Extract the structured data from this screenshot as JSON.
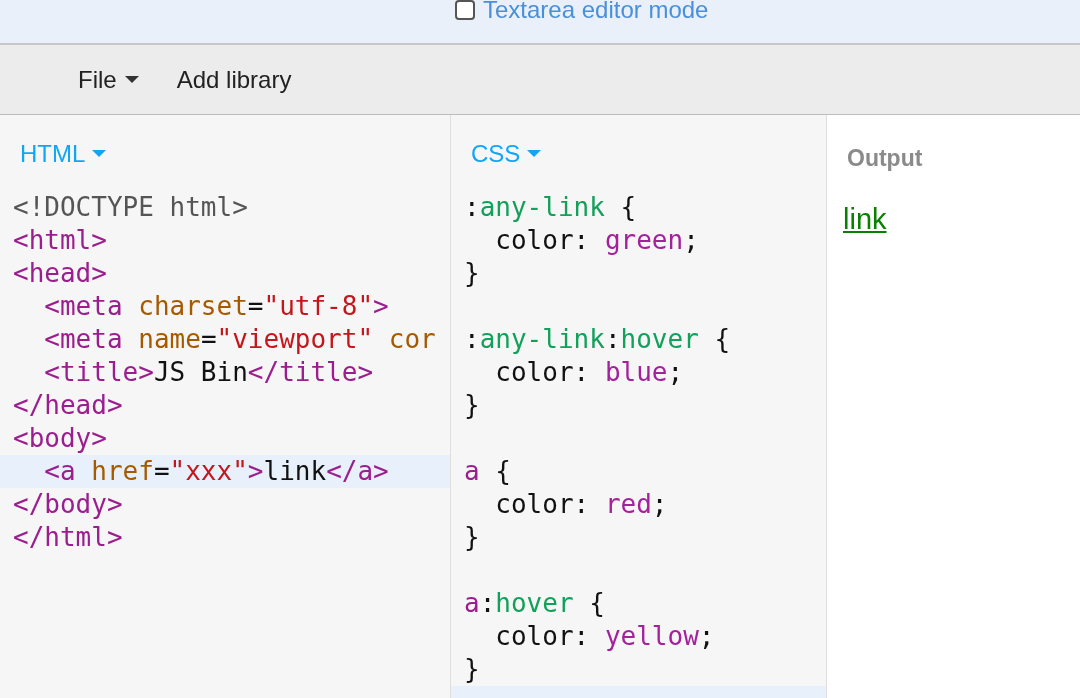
{
  "top_bar": {
    "checkbox": {
      "label": "Textarea editor mode",
      "checked": false
    }
  },
  "toolbar": {
    "items": [
      {
        "label": "File",
        "dropdown": true
      },
      {
        "label": "Add library",
        "dropdown": false
      }
    ]
  },
  "panels": [
    {
      "kind": "html-editor",
      "title": "HTML",
      "lines": [
        {
          "active": false,
          "text": "<!DOCTYPE html>"
        },
        {
          "active": false,
          "text": "<html>"
        },
        {
          "active": false,
          "text": "<head>"
        },
        {
          "active": false,
          "text": "  <meta charset=\"utf-8\">"
        },
        {
          "active": false,
          "text": "  <meta name=\"viewport\" cor"
        },
        {
          "active": false,
          "text": "  <title>JS Bin</title>"
        },
        {
          "active": false,
          "text": "</head>"
        },
        {
          "active": false,
          "text": "<body>"
        },
        {
          "active": true,
          "text": "  <a href=\"xxx\">link</a>"
        },
        {
          "active": false,
          "text": "</body>"
        },
        {
          "active": false,
          "text": "</html>"
        }
      ]
    },
    {
      "kind": "css-editor",
      "title": "CSS",
      "lines": [
        {
          "active": false,
          "text": ":any-link {"
        },
        {
          "active": false,
          "text": "  color: green;"
        },
        {
          "active": false,
          "text": "}"
        },
        {
          "active": false
        },
        {
          "active": false,
          "text": ":any-link:hover {"
        },
        {
          "active": false,
          "text": "  color: blue;"
        },
        {
          "active": false,
          "text": "}"
        },
        {
          "active": false
        },
        {
          "active": false,
          "text": "a {"
        },
        {
          "active": false,
          "text": "  color: red;"
        },
        {
          "active": false,
          "text": "}"
        },
        {
          "active": false
        },
        {
          "active": false,
          "text": "a:hover {"
        },
        {
          "active": false,
          "text": "  color: yellow;"
        },
        {
          "active": false,
          "text": "}"
        },
        {
          "active": true
        }
      ]
    },
    {
      "kind": "output",
      "title": "Output",
      "link": "link"
    }
  ]
}
